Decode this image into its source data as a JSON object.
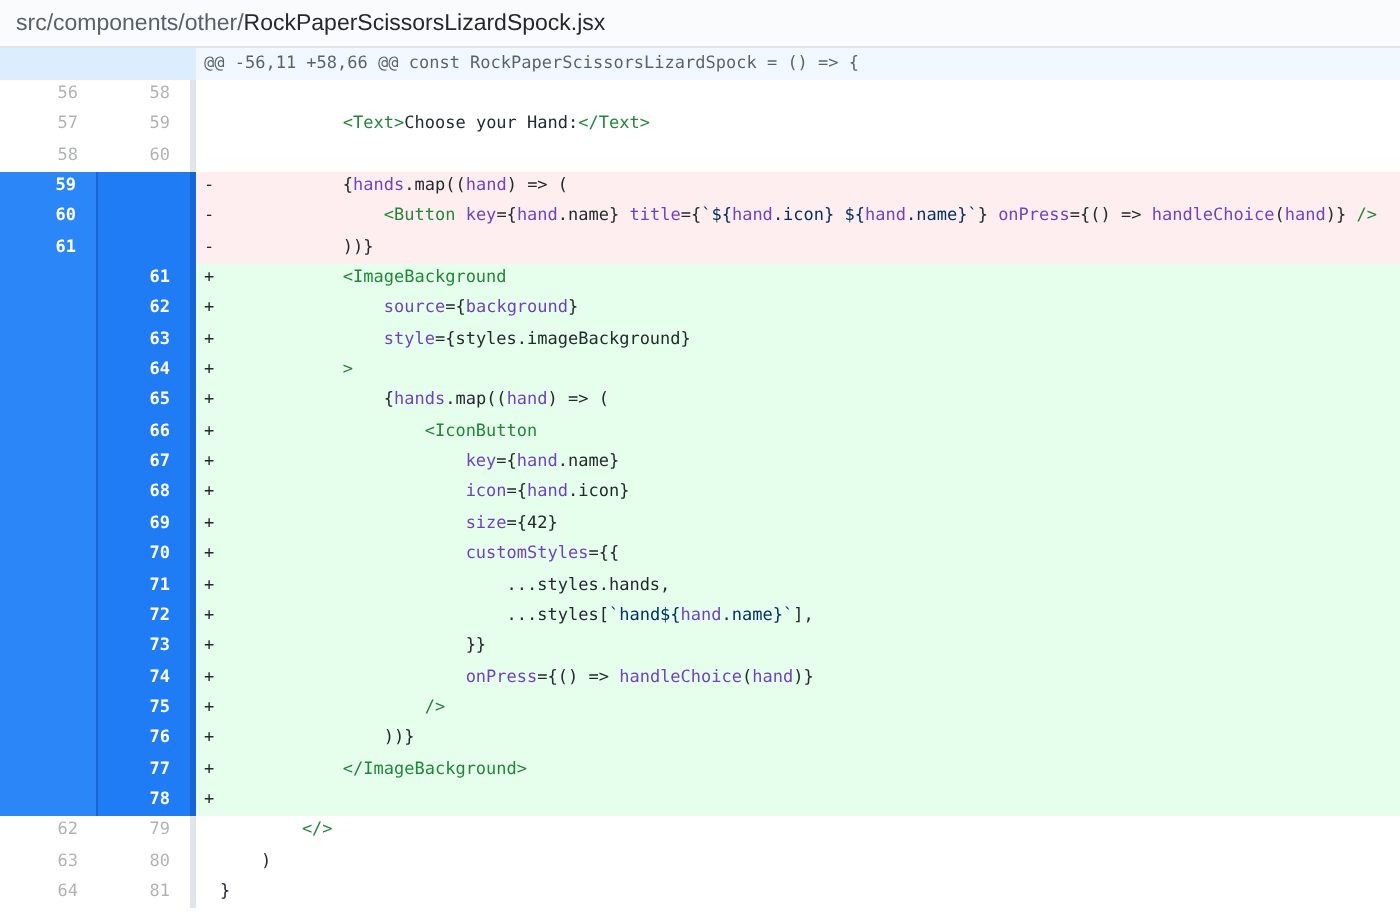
{
  "file_header": {
    "path_prefix": "src/components/other/",
    "file_name": "RockPaperScissorsLizardSpock.jsx"
  },
  "hunk": {
    "text": "@@ -56,11 +58,66 @@ const RockPaperScissorsLizardSpock = () => {"
  },
  "lines": [
    {
      "kind": "context",
      "selected": false,
      "old": "56",
      "new": "58"
    },
    {
      "kind": "context",
      "selected": false,
      "old": "57",
      "new": "59",
      "tokens": [
        {
          "text": "            <Text>",
          "kind": "tag"
        },
        {
          "text": "Choose your Hand:",
          "kind": "plain"
        },
        {
          "text": "</Text>",
          "kind": "tag"
        }
      ]
    },
    {
      "kind": "context",
      "selected": false,
      "old": "58",
      "new": "60"
    },
    {
      "kind": "deletion",
      "selected": true,
      "old": "59",
      "sign": "-",
      "tokens": [
        {
          "text": "            {",
          "kind": "plain"
        },
        {
          "text": "hands",
          "kind": "prop"
        },
        {
          "text": ".map((",
          "kind": "plain"
        },
        {
          "text": "hand",
          "kind": "prop"
        },
        {
          "text": ") => (",
          "kind": "plain"
        }
      ]
    },
    {
      "kind": "deletion",
      "selected": true,
      "old": "60",
      "sign": "-",
      "tokens": [
        {
          "text": "                <Button",
          "kind": "tag"
        },
        {
          "text": " key",
          "kind": "prop"
        },
        {
          "text": "={",
          "kind": "plain"
        },
        {
          "text": "hand",
          "kind": "prop"
        },
        {
          "text": ".name} ",
          "kind": "plain"
        },
        {
          "text": "title",
          "kind": "prop"
        },
        {
          "text": "={",
          "kind": "plain"
        },
        {
          "text": "`${",
          "kind": "str"
        },
        {
          "text": "hand",
          "kind": "prop"
        },
        {
          "text": ".icon} ${",
          "kind": "str"
        },
        {
          "text": "hand",
          "kind": "prop"
        },
        {
          "text": ".name}`",
          "kind": "str"
        },
        {
          "text": "} ",
          "kind": "plain"
        },
        {
          "text": "onPress",
          "kind": "prop"
        },
        {
          "text": "={() => ",
          "kind": "plain"
        },
        {
          "text": "handleChoice",
          "kind": "prop"
        },
        {
          "text": "(",
          "kind": "plain"
        },
        {
          "text": "hand",
          "kind": "prop"
        },
        {
          "text": ")} ",
          "kind": "plain"
        },
        {
          "text": "/>",
          "kind": "tag"
        }
      ]
    },
    {
      "kind": "deletion",
      "selected": true,
      "old": "61",
      "sign": "-",
      "tokens": [
        {
          "text": "            ))}",
          "kind": "plain"
        }
      ]
    },
    {
      "kind": "addition",
      "selected": true,
      "new": "61",
      "sign": "+",
      "tokens": [
        {
          "text": "            <ImageBackground",
          "kind": "tag"
        }
      ]
    },
    {
      "kind": "addition",
      "selected": true,
      "new": "62",
      "sign": "+",
      "tokens": [
        {
          "text": "                source",
          "kind": "prop"
        },
        {
          "text": "={",
          "kind": "plain"
        },
        {
          "text": "background",
          "kind": "prop"
        },
        {
          "text": "}",
          "kind": "plain"
        }
      ]
    },
    {
      "kind": "addition",
      "selected": true,
      "new": "63",
      "sign": "+",
      "tokens": [
        {
          "text": "                style",
          "kind": "prop"
        },
        {
          "text": "={styles.imageBackground}",
          "kind": "plain"
        }
      ]
    },
    {
      "kind": "addition",
      "selected": true,
      "new": "64",
      "sign": "+",
      "tokens": [
        {
          "text": "            >",
          "kind": "tag"
        }
      ]
    },
    {
      "kind": "addition",
      "selected": true,
      "new": "65",
      "sign": "+",
      "tokens": [
        {
          "text": "                {",
          "kind": "plain"
        },
        {
          "text": "hands",
          "kind": "prop"
        },
        {
          "text": ".map((",
          "kind": "plain"
        },
        {
          "text": "hand",
          "kind": "prop"
        },
        {
          "text": ") => (",
          "kind": "plain"
        }
      ]
    },
    {
      "kind": "addition",
      "selected": true,
      "new": "66",
      "sign": "+",
      "tokens": [
        {
          "text": "                    <IconButton",
          "kind": "tag"
        }
      ]
    },
    {
      "kind": "addition",
      "selected": true,
      "new": "67",
      "sign": "+",
      "tokens": [
        {
          "text": "                        key",
          "kind": "prop"
        },
        {
          "text": "={",
          "kind": "plain"
        },
        {
          "text": "hand",
          "kind": "prop"
        },
        {
          "text": ".name}",
          "kind": "plain"
        }
      ]
    },
    {
      "kind": "addition",
      "selected": true,
      "new": "68",
      "sign": "+",
      "tokens": [
        {
          "text": "                        icon",
          "kind": "prop"
        },
        {
          "text": "={",
          "kind": "plain"
        },
        {
          "text": "hand",
          "kind": "prop"
        },
        {
          "text": ".icon}",
          "kind": "plain"
        }
      ]
    },
    {
      "kind": "addition",
      "selected": true,
      "new": "69",
      "sign": "+",
      "tokens": [
        {
          "text": "                        size",
          "kind": "prop"
        },
        {
          "text": "={42}",
          "kind": "plain"
        }
      ]
    },
    {
      "kind": "addition",
      "selected": true,
      "new": "70",
      "sign": "+",
      "tokens": [
        {
          "text": "                        customStyles",
          "kind": "prop"
        },
        {
          "text": "={{",
          "kind": "plain"
        }
      ]
    },
    {
      "kind": "addition",
      "selected": true,
      "new": "71",
      "sign": "+",
      "tokens": [
        {
          "text": "                            ...styles.hands,",
          "kind": "plain"
        }
      ]
    },
    {
      "kind": "addition",
      "selected": true,
      "new": "72",
      "sign": "+",
      "tokens": [
        {
          "text": "                            ...styles[",
          "kind": "plain"
        },
        {
          "text": "`hand${",
          "kind": "str"
        },
        {
          "text": "hand",
          "kind": "prop"
        },
        {
          "text": ".name}`",
          "kind": "str"
        },
        {
          "text": "],",
          "kind": "plain"
        }
      ]
    },
    {
      "kind": "addition",
      "selected": true,
      "new": "73",
      "sign": "+",
      "tokens": [
        {
          "text": "                        }}",
          "kind": "plain"
        }
      ]
    },
    {
      "kind": "addition",
      "selected": true,
      "new": "74",
      "sign": "+",
      "tokens": [
        {
          "text": "                        onPress",
          "kind": "prop"
        },
        {
          "text": "={() => ",
          "kind": "plain"
        },
        {
          "text": "handleChoice",
          "kind": "prop"
        },
        {
          "text": "(",
          "kind": "plain"
        },
        {
          "text": "hand",
          "kind": "prop"
        },
        {
          "text": ")}",
          "kind": "plain"
        }
      ]
    },
    {
      "kind": "addition",
      "selected": true,
      "new": "75",
      "sign": "+",
      "tokens": [
        {
          "text": "                    />",
          "kind": "tag"
        }
      ]
    },
    {
      "kind": "addition",
      "selected": true,
      "new": "76",
      "sign": "+",
      "tokens": [
        {
          "text": "                ))}",
          "kind": "plain"
        }
      ]
    },
    {
      "kind": "addition",
      "selected": true,
      "new": "77",
      "sign": "+",
      "tokens": [
        {
          "text": "            </ImageBackground>",
          "kind": "tag"
        }
      ]
    },
    {
      "kind": "addition",
      "selected": true,
      "new": "78",
      "sign": "+"
    },
    {
      "kind": "context",
      "selected": false,
      "old": "62",
      "new": "79",
      "tokens": [
        {
          "text": "        </>",
          "kind": "tag"
        }
      ]
    },
    {
      "kind": "context",
      "selected": false,
      "old": "63",
      "new": "80",
      "tokens": [
        {
          "text": "    )",
          "kind": "plain"
        }
      ]
    },
    {
      "kind": "context",
      "selected": false,
      "old": "64",
      "new": "81",
      "tokens": [
        {
          "text": "}",
          "kind": "plain"
        }
      ]
    }
  ]
}
